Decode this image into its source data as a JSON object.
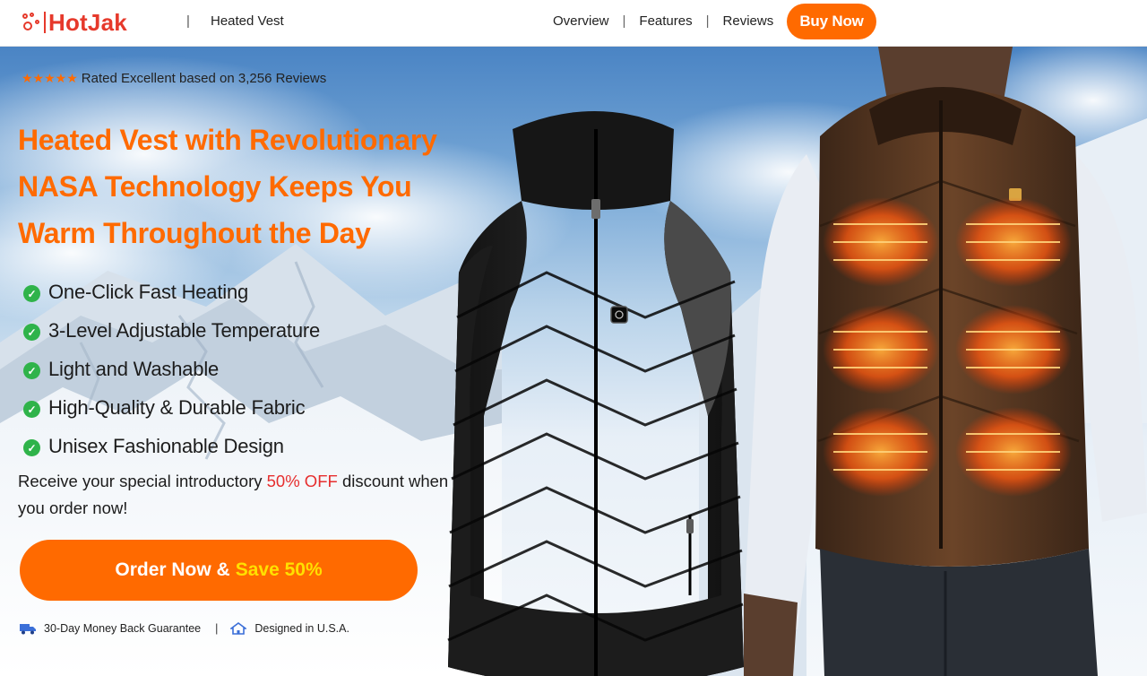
{
  "brand": {
    "name": "HotJak",
    "accent_color": "#ff6a00",
    "logo_color": "#e6392b"
  },
  "header": {
    "product_name": "Heated Vest",
    "nav": [
      {
        "label": "Overview"
      },
      {
        "label": "Features"
      },
      {
        "label": "Reviews"
      }
    ],
    "buy_label": "Buy Now"
  },
  "hero": {
    "rating": {
      "stars": 5,
      "text": "Rated Excellent based on 3,256 Reviews"
    },
    "headline_lines": [
      "Heated Vest with Revolutionary",
      "NASA Technology Keeps You",
      "Warm Throughout the Day"
    ],
    "features": [
      "One-Click Fast Heating",
      "3-Level Adjustable Temperature",
      "Light and Washable",
      "High-Quality & Durable Fabric",
      "Unisex Fashionable Design"
    ],
    "promo": {
      "before": "Receive your special introductory ",
      "highlight": "50% OFF",
      "after": " discount when you order now!"
    },
    "cta": {
      "main": "Order Now &",
      "save": "Save 50%"
    },
    "guarantees": [
      {
        "icon": "truck-icon",
        "label": "30-Day Money Back Guarantee"
      },
      {
        "icon": "home-icon",
        "label": "Designed in U.S.A."
      }
    ]
  }
}
